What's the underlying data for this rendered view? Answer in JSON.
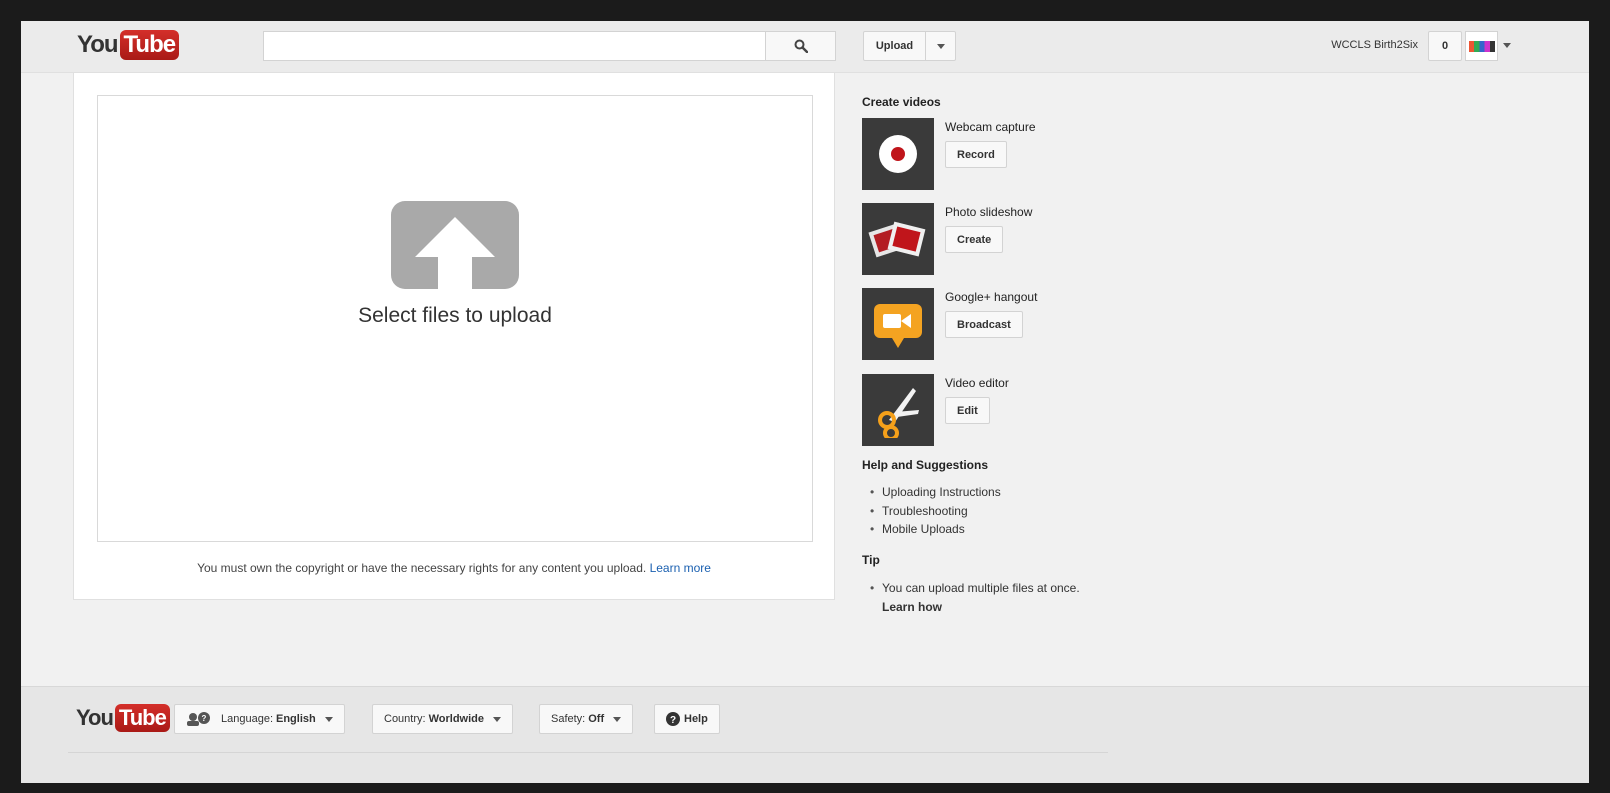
{
  "header": {
    "logo": {
      "you": "You",
      "tube": "Tube"
    },
    "search": {
      "value": "",
      "placeholder": ""
    },
    "upload_label": "Upload",
    "username": "WCCLS Birth2Six",
    "notification_count": "0"
  },
  "upload": {
    "select_text": "Select files to upload",
    "copyright_text": "You must own the copyright or have the necessary rights for any content you upload.",
    "learn_more": "Learn more"
  },
  "sidebar": {
    "create_title": "Create videos",
    "items": [
      {
        "title": "Webcam capture",
        "button": "Record",
        "icon": "record-icon"
      },
      {
        "title": "Photo slideshow",
        "button": "Create",
        "icon": "photo-slideshow-icon"
      },
      {
        "title": "Google+ hangout",
        "button": "Broadcast",
        "icon": "hangout-camera-icon"
      },
      {
        "title": "Video editor",
        "button": "Edit",
        "icon": "scissors-icon"
      }
    ],
    "help_title": "Help and Suggestions",
    "help_links": [
      "Uploading Instructions",
      "Troubleshooting",
      "Mobile Uploads"
    ],
    "tip_title": "Tip",
    "tip_text": "You can upload multiple files at once.",
    "tip_link": "Learn how"
  },
  "footer": {
    "logo": {
      "you": "You",
      "tube": "Tube"
    },
    "language_label": "Language:",
    "language_value": "English",
    "country_label": "Country:",
    "country_value": "Worldwide",
    "safety_label": "Safety:",
    "safety_value": "Off",
    "help_label": "Help"
  },
  "colors": {
    "brand_red": "#c4302b",
    "link_blue": "#1b60b0",
    "hangout_orange": "#f4a321",
    "editor_orange": "#f5a01a"
  }
}
